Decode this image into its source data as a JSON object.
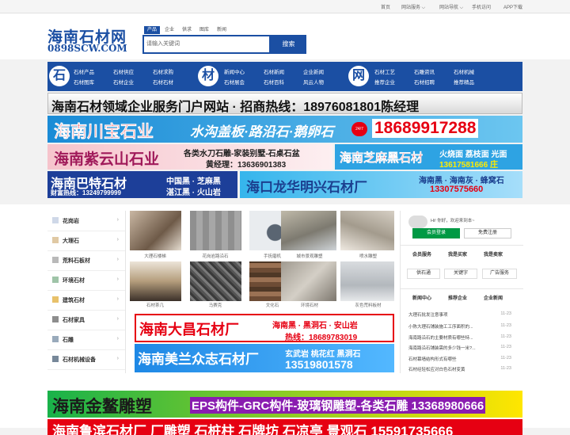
{
  "topnav": [
    "首页",
    "网站服务 ⌵",
    "网站导航 ⌵",
    "手机访问",
    "APP下载"
  ],
  "logo": {
    "cn": "海南石材网",
    "en": "0898SCW.COM"
  },
  "search": {
    "tabs": [
      "产品",
      "企业",
      "供求",
      "图库",
      "新闻"
    ],
    "placeholder": "请输入关键词",
    "button": "搜索"
  },
  "nav": {
    "badges": [
      "石",
      "材",
      "网"
    ],
    "g1": [
      [
        "石材产品",
        "石材供应",
        "石材求购"
      ],
      [
        "石材图库",
        "石材企业",
        "石材石材"
      ]
    ],
    "g2": [
      [
        "新闻中心",
        "石材新闻",
        "企业新闻"
      ],
      [
        "石材展会",
        "石材百科",
        "风云人物"
      ]
    ],
    "g3": [
      [
        "石材工艺",
        "石雕资讯",
        "石材机械"
      ],
      [
        "推荐企业",
        "石材招聘",
        "推荐精品"
      ]
    ]
  },
  "banners": {
    "b1": "海南石材领域企业服务门户网站 · 招商热线：18976081801陈经理",
    "b2a": "海南川宝石业",
    "b2b": "水沟盖板·路沿石·鹅卵石",
    "b2badge": "24/7",
    "b2c": "18689917288",
    "b3a": "海南紫云山石业",
    "b3b": "各类水刀石雕-家装别墅-石桌石盆",
    "b3c": "黄经理：13636901383",
    "b4a": "海南芝麻黑石材",
    "b4b": "火烧面 荔枝面 光面",
    "b4c": "13617581666 庄",
    "b5a": "海南巴特石材",
    "b5b": "财富热线：13249799999",
    "b5c": "中国黑 · 芝麻黑",
    "b5d": "湛江黑 · 火山岩",
    "b6a": "海口龙华明兴石材厂",
    "b6b": "海南黑 · 海南灰 · 蜂窝石",
    "b6c": "13307575660",
    "b7a": "海南大昌石材厂",
    "b7b": "海南黑 · 黑洞石 · 安山岩",
    "b7c": "热线：18689783019",
    "b8a": "海南美兰众志石材厂",
    "b8b": "玄武岩 桃花红 黑洞石",
    "b8c": "13519801578",
    "b9a": "海南金鳌雕塑",
    "b9b": "EPS构件-GRC构件-玻璃钢雕塑-各类石雕 13368980666",
    "b10": "海南鲁滨石材厂 厂雕塑 石桩柱 石牌坊 石凉亭 景观石 15591735666"
  },
  "sidebar": [
    "花岗岩",
    "大理石",
    "荒料石板材",
    "环境石材",
    "建筑石材",
    "石材家具",
    "石雕",
    "石材机械设备"
  ],
  "thumbs": [
    "大理石楼梯",
    "花岗岩路沿石",
    "手抚磨机",
    "城市景观雕塑",
    "喷水雕塑",
    "石材茶几",
    "马赛克",
    "文化石",
    "环境石材",
    "灰色荒料板材"
  ],
  "right": {
    "greeting": "Hi! 你好，欢迎来到本~",
    "login": "会员登录",
    "register": "免费注册",
    "tabs1": [
      "会员服务",
      "我是买家",
      "我是卖家"
    ],
    "btns": [
      "供石通",
      "关键字",
      "广告服务"
    ],
    "tabs2": [
      "新闻中心",
      "推荐企业",
      "企业新闻"
    ],
    "news": [
      [
        "大理石批发注意事项",
        "11-23"
      ],
      [
        "小陈大理石铺装施工工序面积的...",
        "11-23"
      ],
      [
        "海南路沿石的主要材质有哪些特...",
        "11-23"
      ],
      [
        "海南路沿石铺装需的多少钱一米?...",
        "11-23"
      ],
      [
        "石材幕墙结构形式有哪些",
        "11-23"
      ],
      [
        "石材经轻松应对白色石材变黄",
        "11-23"
      ]
    ]
  },
  "colors": {
    "brand": "#1b4fa3",
    "red": "#e60012",
    "green": "#009944"
  }
}
